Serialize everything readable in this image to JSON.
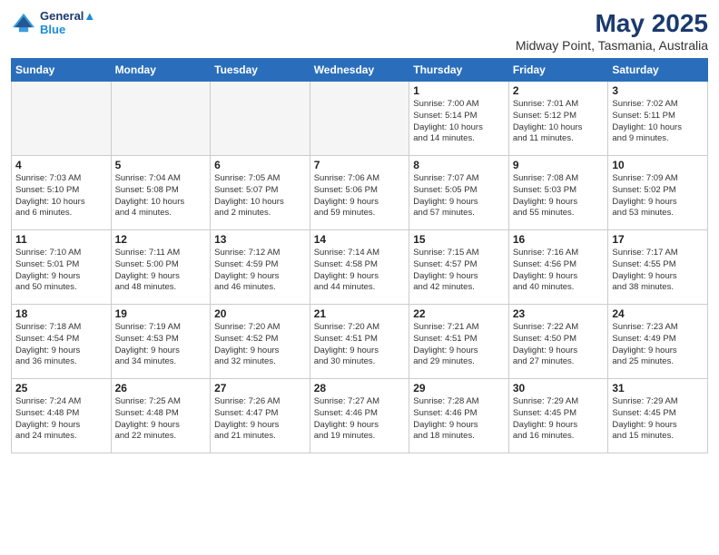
{
  "header": {
    "logo_line1": "General",
    "logo_line2": "Blue",
    "month": "May 2025",
    "location": "Midway Point, Tasmania, Australia"
  },
  "weekdays": [
    "Sunday",
    "Monday",
    "Tuesday",
    "Wednesday",
    "Thursday",
    "Friday",
    "Saturday"
  ],
  "weeks": [
    [
      {
        "day": "",
        "info": ""
      },
      {
        "day": "",
        "info": ""
      },
      {
        "day": "",
        "info": ""
      },
      {
        "day": "",
        "info": ""
      },
      {
        "day": "1",
        "info": "Sunrise: 7:00 AM\nSunset: 5:14 PM\nDaylight: 10 hours\nand 14 minutes."
      },
      {
        "day": "2",
        "info": "Sunrise: 7:01 AM\nSunset: 5:12 PM\nDaylight: 10 hours\nand 11 minutes."
      },
      {
        "day": "3",
        "info": "Sunrise: 7:02 AM\nSunset: 5:11 PM\nDaylight: 10 hours\nand 9 minutes."
      }
    ],
    [
      {
        "day": "4",
        "info": "Sunrise: 7:03 AM\nSunset: 5:10 PM\nDaylight: 10 hours\nand 6 minutes."
      },
      {
        "day": "5",
        "info": "Sunrise: 7:04 AM\nSunset: 5:08 PM\nDaylight: 10 hours\nand 4 minutes."
      },
      {
        "day": "6",
        "info": "Sunrise: 7:05 AM\nSunset: 5:07 PM\nDaylight: 10 hours\nand 2 minutes."
      },
      {
        "day": "7",
        "info": "Sunrise: 7:06 AM\nSunset: 5:06 PM\nDaylight: 9 hours\nand 59 minutes."
      },
      {
        "day": "8",
        "info": "Sunrise: 7:07 AM\nSunset: 5:05 PM\nDaylight: 9 hours\nand 57 minutes."
      },
      {
        "day": "9",
        "info": "Sunrise: 7:08 AM\nSunset: 5:03 PM\nDaylight: 9 hours\nand 55 minutes."
      },
      {
        "day": "10",
        "info": "Sunrise: 7:09 AM\nSunset: 5:02 PM\nDaylight: 9 hours\nand 53 minutes."
      }
    ],
    [
      {
        "day": "11",
        "info": "Sunrise: 7:10 AM\nSunset: 5:01 PM\nDaylight: 9 hours\nand 50 minutes."
      },
      {
        "day": "12",
        "info": "Sunrise: 7:11 AM\nSunset: 5:00 PM\nDaylight: 9 hours\nand 48 minutes."
      },
      {
        "day": "13",
        "info": "Sunrise: 7:12 AM\nSunset: 4:59 PM\nDaylight: 9 hours\nand 46 minutes."
      },
      {
        "day": "14",
        "info": "Sunrise: 7:14 AM\nSunset: 4:58 PM\nDaylight: 9 hours\nand 44 minutes."
      },
      {
        "day": "15",
        "info": "Sunrise: 7:15 AM\nSunset: 4:57 PM\nDaylight: 9 hours\nand 42 minutes."
      },
      {
        "day": "16",
        "info": "Sunrise: 7:16 AM\nSunset: 4:56 PM\nDaylight: 9 hours\nand 40 minutes."
      },
      {
        "day": "17",
        "info": "Sunrise: 7:17 AM\nSunset: 4:55 PM\nDaylight: 9 hours\nand 38 minutes."
      }
    ],
    [
      {
        "day": "18",
        "info": "Sunrise: 7:18 AM\nSunset: 4:54 PM\nDaylight: 9 hours\nand 36 minutes."
      },
      {
        "day": "19",
        "info": "Sunrise: 7:19 AM\nSunset: 4:53 PM\nDaylight: 9 hours\nand 34 minutes."
      },
      {
        "day": "20",
        "info": "Sunrise: 7:20 AM\nSunset: 4:52 PM\nDaylight: 9 hours\nand 32 minutes."
      },
      {
        "day": "21",
        "info": "Sunrise: 7:20 AM\nSunset: 4:51 PM\nDaylight: 9 hours\nand 30 minutes."
      },
      {
        "day": "22",
        "info": "Sunrise: 7:21 AM\nSunset: 4:51 PM\nDaylight: 9 hours\nand 29 minutes."
      },
      {
        "day": "23",
        "info": "Sunrise: 7:22 AM\nSunset: 4:50 PM\nDaylight: 9 hours\nand 27 minutes."
      },
      {
        "day": "24",
        "info": "Sunrise: 7:23 AM\nSunset: 4:49 PM\nDaylight: 9 hours\nand 25 minutes."
      }
    ],
    [
      {
        "day": "25",
        "info": "Sunrise: 7:24 AM\nSunset: 4:48 PM\nDaylight: 9 hours\nand 24 minutes."
      },
      {
        "day": "26",
        "info": "Sunrise: 7:25 AM\nSunset: 4:48 PM\nDaylight: 9 hours\nand 22 minutes."
      },
      {
        "day": "27",
        "info": "Sunrise: 7:26 AM\nSunset: 4:47 PM\nDaylight: 9 hours\nand 21 minutes."
      },
      {
        "day": "28",
        "info": "Sunrise: 7:27 AM\nSunset: 4:46 PM\nDaylight: 9 hours\nand 19 minutes."
      },
      {
        "day": "29",
        "info": "Sunrise: 7:28 AM\nSunset: 4:46 PM\nDaylight: 9 hours\nand 18 minutes."
      },
      {
        "day": "30",
        "info": "Sunrise: 7:29 AM\nSunset: 4:45 PM\nDaylight: 9 hours\nand 16 minutes."
      },
      {
        "day": "31",
        "info": "Sunrise: 7:29 AM\nSunset: 4:45 PM\nDaylight: 9 hours\nand 15 minutes."
      }
    ]
  ]
}
